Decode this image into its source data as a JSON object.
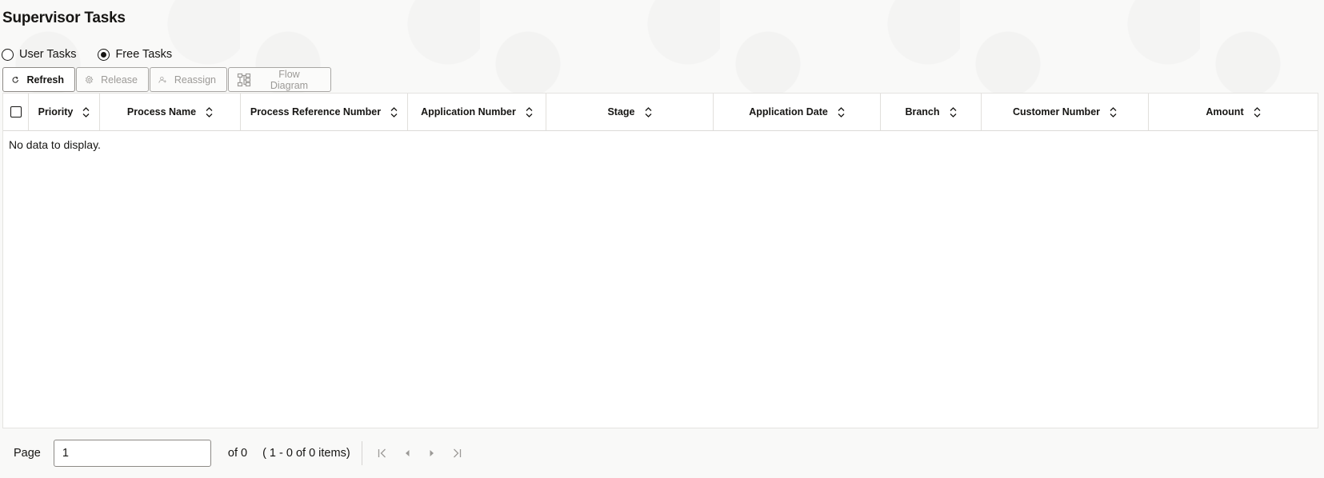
{
  "page_title": "Supervisor Tasks",
  "task_filter": {
    "options": [
      {
        "label": "User Tasks",
        "selected": false
      },
      {
        "label": "Free Tasks",
        "selected": true
      }
    ]
  },
  "toolbar": {
    "refresh": {
      "label": "Refresh",
      "icon": "refresh-icon",
      "enabled": true
    },
    "release": {
      "label": "Release",
      "icon": "release-icon",
      "enabled": false
    },
    "reassign": {
      "label": "Reassign",
      "icon": "reassign-user-icon",
      "enabled": false
    },
    "flow_diagram": {
      "label": "Flow Diagram",
      "icon": "flow-diagram-icon",
      "enabled": false
    }
  },
  "table": {
    "columns": [
      "Priority",
      "Process Name",
      "Process Reference Number",
      "Application Number",
      "Stage",
      "Application Date",
      "Branch",
      "Customer Number",
      "Amount"
    ],
    "rows": [],
    "empty_message": "No data to display."
  },
  "pagination": {
    "page_label": "Page",
    "current_page": "1",
    "of_label": "of 0",
    "items_label": "( 1 - 0 of 0 items)"
  },
  "colors": {
    "text": "#161513",
    "disabled_text": "#9c9a97",
    "border": "#a8a6a3",
    "background": "#f9f9f8"
  }
}
